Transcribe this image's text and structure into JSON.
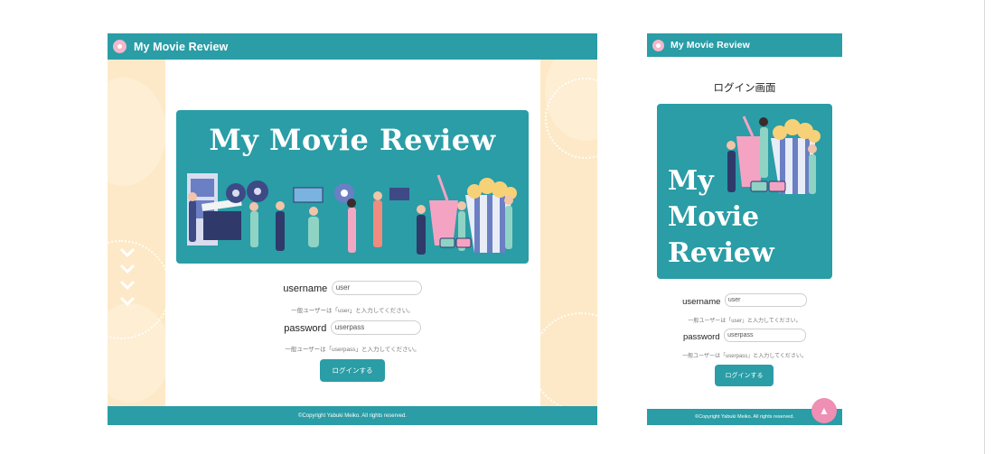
{
  "app": {
    "title": "My Movie Review"
  },
  "login": {
    "heading": "ログイン画面",
    "banner_text": "My Movie Review",
    "banner_text_lines": [
      "My",
      "Movie",
      "Review"
    ],
    "username_label": "username",
    "username_value": "user",
    "username_hint": "一般ユーザーは「user」と入力してください。",
    "password_label": "password",
    "password_value": "userpass",
    "password_hint": "一般ユーザーは「userpass」と入力してください。",
    "submit_label": "ログインする"
  },
  "footer": {
    "copyright": "©Copyright Yabuki Meiko. All rights reserved."
  },
  "icons": [
    "logo-icon",
    "chevron-down-icon",
    "arrow-up-icon"
  ],
  "colors": {
    "brand": "#2a9da6",
    "accent_pink": "#ee8fb3",
    "side_bg": "#fde9c7"
  }
}
